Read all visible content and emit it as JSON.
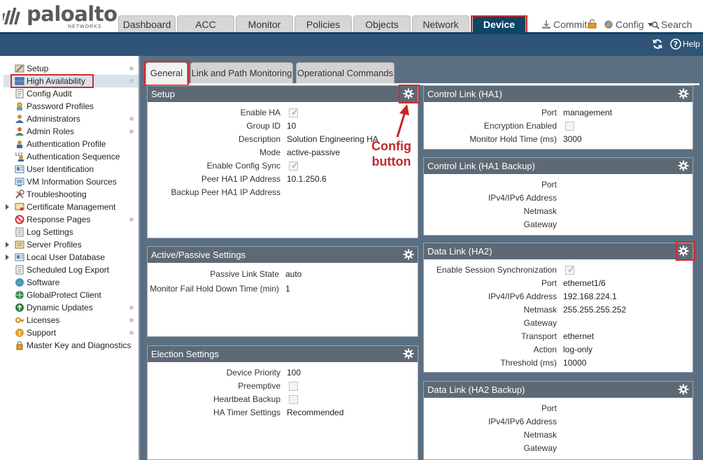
{
  "brand": {
    "name": "paloalto",
    "sub": "NETWORKS"
  },
  "nav": {
    "tabs": [
      "Dashboard",
      "ACC",
      "Monitor",
      "Policies",
      "Objects",
      "Network",
      "Device"
    ],
    "active": "Device"
  },
  "header_actions": {
    "commit": "Commit",
    "config": "Config",
    "search": "Search"
  },
  "toolbar": {
    "help": "Help"
  },
  "sidebar": {
    "items": [
      {
        "label": "Setup",
        "icon": "setup-icon"
      },
      {
        "label": "High Availability",
        "icon": "ha-icon"
      },
      {
        "label": "Config Audit",
        "icon": "audit-icon"
      },
      {
        "label": "Password Profiles",
        "icon": "password-icon"
      },
      {
        "label": "Administrators",
        "icon": "admin-icon"
      },
      {
        "label": "Admin Roles",
        "icon": "roles-icon"
      },
      {
        "label": "Authentication Profile",
        "icon": "auth-profile-icon"
      },
      {
        "label": "Authentication Sequence",
        "icon": "auth-sequence-icon"
      },
      {
        "label": "User Identification",
        "icon": "user-id-icon"
      },
      {
        "label": "VM Information Sources",
        "icon": "vm-icon"
      },
      {
        "label": "Troubleshooting",
        "icon": "wrench-icon"
      },
      {
        "label": "Certificate Management",
        "icon": "certificate-icon"
      },
      {
        "label": "Response Pages",
        "icon": "response-pages-icon"
      },
      {
        "label": "Log Settings",
        "icon": "log-icon"
      },
      {
        "label": "Server Profiles",
        "icon": "server-icon"
      },
      {
        "label": "Local User Database",
        "icon": "database-icon"
      },
      {
        "label": "Scheduled Log Export",
        "icon": "export-icon"
      },
      {
        "label": "Software",
        "icon": "software-icon"
      },
      {
        "label": "GlobalProtect Client",
        "icon": "globe-icon"
      },
      {
        "label": "Dynamic Updates",
        "icon": "updates-icon"
      },
      {
        "label": "Licenses",
        "icon": "license-icon"
      },
      {
        "label": "Support",
        "icon": "support-icon"
      },
      {
        "label": "Master Key and Diagnostics",
        "icon": "key-icon"
      }
    ]
  },
  "subtabs": [
    "General",
    "Link and Path Monitoring",
    "Operational Commands"
  ],
  "panels": {
    "setup": {
      "title": "Setup",
      "enable_ha": "Enable HA",
      "group_id": "Group ID",
      "group_id_val": "10",
      "description": "Description",
      "description_val": "Solution Engineering HA",
      "mode": "Mode",
      "mode_val": "active-passive",
      "config_sync": "Enable Config Sync",
      "peer_ip": "Peer HA1 IP Address",
      "peer_ip_val": "10.1.250.6",
      "backup_peer": "Backup Peer HA1 IP Address"
    },
    "active_passive": {
      "title": "Active/Passive Settings",
      "passive_link": "Passive Link State",
      "passive_link_val": "auto",
      "fail_hold": "Monitor Fail Hold Down Time (min)",
      "fail_hold_val": "1"
    },
    "election": {
      "title": "Election Settings",
      "priority": "Device Priority",
      "priority_val": "100",
      "preemptive": "Preemptive",
      "heartbeat": "Heartbeat Backup",
      "timer": "HA Timer Settings",
      "timer_val": "Recommended"
    },
    "ha1": {
      "title": "Control Link (HA1)",
      "port": "Port",
      "port_val": "management",
      "encryption": "Encryption Enabled",
      "hold": "Monitor Hold Time (ms)",
      "hold_val": "3000"
    },
    "ha1_backup": {
      "title": "Control Link (HA1 Backup)",
      "port": "Port",
      "ip": "IPv4/IPv6 Address",
      "netmask": "Netmask",
      "gateway": "Gateway"
    },
    "ha2": {
      "title": "Data Link (HA2)",
      "session_sync": "Enable Session Synchronization",
      "port": "Port",
      "port_val": "ethernet1/6",
      "ip": "IPv4/IPv6 Address",
      "ip_val": "192.168.224.1",
      "netmask": "Netmask",
      "netmask_val": "255.255.255.252",
      "gateway": "Gateway",
      "transport": "Transport",
      "transport_val": "ethernet",
      "action": "Action",
      "action_val": "log-only",
      "threshold": "Threshold (ms)",
      "threshold_val": "10000"
    },
    "ha2_backup": {
      "title": "Data Link (HA2 Backup)",
      "port": "Port",
      "ip": "IPv4/IPv6 Address",
      "netmask": "Netmask",
      "gateway": "Gateway"
    }
  },
  "annotation": {
    "line1": "Config",
    "line2": "button"
  },
  "colors": {
    "accent_red": "#d42a2a",
    "nav_active": "#0d4566",
    "panel_header": "#5d6a76",
    "main_bg": "#5b6f82"
  }
}
